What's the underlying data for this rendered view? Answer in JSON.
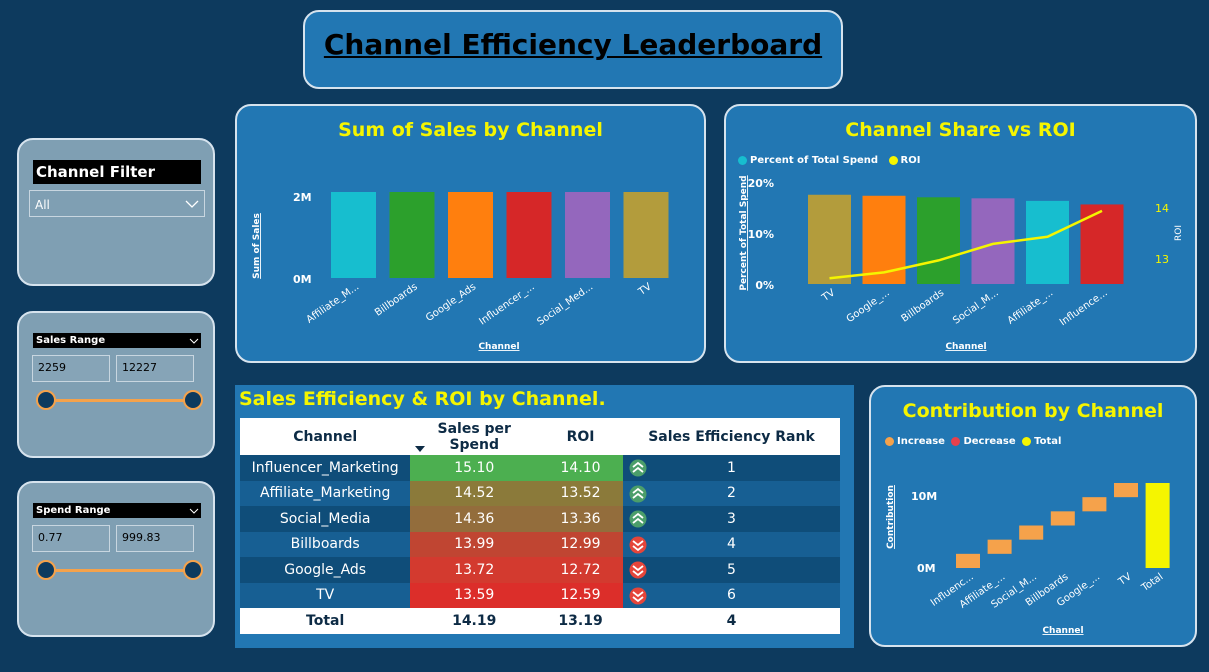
{
  "title": "Channel Efficiency Leaderboard",
  "filters": {
    "channel": {
      "label": "Channel Filter",
      "value": "All"
    },
    "sales_range": {
      "label": "Sales Range",
      "min": "2259",
      "max": "12227"
    },
    "spend_range": {
      "label": "Spend Range",
      "min": "0.77",
      "max": "999.83"
    }
  },
  "colors": {
    "background": "#0d3a5e",
    "card": "#2277b3",
    "title_yellow": "#f5f500",
    "slider": "#f5a24b"
  },
  "chart_data": [
    {
      "type": "bar",
      "title": "Sum of Sales by Channel",
      "xlabel": "Channel",
      "ylabel": "Sum of Sales",
      "yticks": [
        "2M",
        "0M"
      ],
      "categories": [
        "Affiliate_M...",
        "Billboards",
        "Google_Ads",
        "Influencer_...",
        "Social_Med...",
        "TV"
      ],
      "values": [
        2000000,
        2000000,
        2000000,
        2000000,
        2000000,
        2000000
      ],
      "colors": [
        "#17becf",
        "#2ca02c",
        "#ff7f0e",
        "#d62728",
        "#9467bd",
        "#b39c3c"
      ],
      "ylim": [
        0,
        2000000
      ]
    },
    {
      "type": "bar+line",
      "title": "Channel Share vs ROI",
      "xlabel": "Channel",
      "ylabel": "Percent of Total Spend",
      "y2label": "ROI",
      "legend": [
        "Percent of Total Spend",
        "ROI"
      ],
      "legend_colors": [
        "#17becf",
        "#f5f500"
      ],
      "yticks": [
        "20%",
        "10%",
        "0%"
      ],
      "y2ticks": [
        "14",
        "13"
      ],
      "categories": [
        "TV",
        "Google_...",
        "Billboards",
        "Social_M...",
        "Affiliate_...",
        "Influence..."
      ],
      "bar_values": [
        17.5,
        17.3,
        17.0,
        16.8,
        16.3,
        15.6
      ],
      "bar_colors": [
        "#b39c3c",
        "#ff7f0e",
        "#2ca02c",
        "#9467bd",
        "#17becf",
        "#d62728"
      ],
      "line_values": [
        12.59,
        12.72,
        12.99,
        13.36,
        13.52,
        14.1
      ],
      "ylim": [
        0,
        20
      ],
      "y2lim": [
        12.55,
        14.3
      ]
    },
    {
      "type": "waterfall",
      "title": "Contribution by Channel",
      "xlabel": "Channel",
      "ylabel": "Contribution",
      "legend": [
        "Increase",
        "Decrease",
        "Total"
      ],
      "legend_colors": [
        "#f5a24b",
        "#e8404c",
        "#f5f500"
      ],
      "yticks": [
        "10M",
        "0M"
      ],
      "categories": [
        "Influenc...",
        "Affiliate_...",
        "Social_M...",
        "Billboards",
        "Google_...",
        "TV",
        "Total"
      ],
      "values": [
        2000000,
        2000000,
        2000000,
        2000000,
        2000000,
        2000000,
        12000000
      ],
      "bar_colors": [
        "#f5a24b",
        "#f5a24b",
        "#f5a24b",
        "#f5a24b",
        "#f5a24b",
        "#f5a24b",
        "#f5f500"
      ],
      "ylim": [
        0,
        12000000
      ]
    }
  ],
  "table": {
    "title": "Sales Efficiency & ROI by Channel.",
    "columns": [
      "Channel",
      "Sales per Spend",
      "ROI",
      "Sales Efficiency Rank"
    ],
    "rows": [
      {
        "channel": "Influencer_Marketing",
        "sps": "15.10",
        "roi": "14.10",
        "rank": "1",
        "trend": "up",
        "color": "#4caf50"
      },
      {
        "channel": "Affiliate_Marketing",
        "sps": "14.52",
        "roi": "13.52",
        "rank": "2",
        "trend": "up",
        "color": "#8b7a3a"
      },
      {
        "channel": "Social_Media",
        "sps": "14.36",
        "roi": "13.36",
        "rank": "3",
        "trend": "up",
        "color": "#936d3c"
      },
      {
        "channel": "Billboards",
        "sps": "13.99",
        "roi": "12.99",
        "rank": "4",
        "trend": "down",
        "color": "#c04532"
      },
      {
        "channel": "Google_Ads",
        "sps": "13.72",
        "roi": "12.72",
        "rank": "5",
        "trend": "down",
        "color": "#d33a2f"
      },
      {
        "channel": "TV",
        "sps": "13.59",
        "roi": "12.59",
        "rank": "6",
        "trend": "down",
        "color": "#dc2e2a"
      }
    ],
    "total": {
      "label": "Total",
      "sps": "14.19",
      "roi": "13.19",
      "rank": "4"
    }
  }
}
